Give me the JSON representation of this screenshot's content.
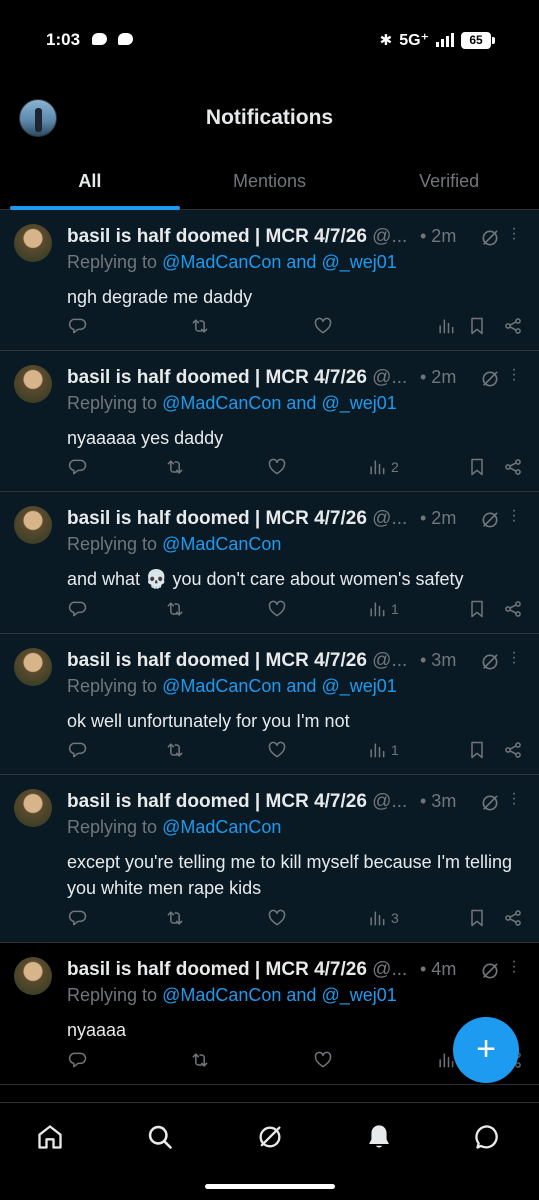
{
  "status": {
    "time": "1:03",
    "network": "5G⁺",
    "battery": "65"
  },
  "header": {
    "title": "Notifications"
  },
  "tabs": [
    {
      "label": "All",
      "active": true
    },
    {
      "label": "Mentions",
      "active": false
    },
    {
      "label": "Verified",
      "active": false
    }
  ],
  "tweets": [
    {
      "name": "basil is half doomed | MCR 4/7/26",
      "handle": "@...",
      "time": "• 2m",
      "reply_prefix": "Replying to",
      "mentions": "@MadCanCon and @_wej01",
      "text": "ngh degrade me daddy",
      "views": ""
    },
    {
      "name": "basil is half doomed | MCR 4/7/26",
      "handle": "@...",
      "time": "• 2m",
      "reply_prefix": "Replying to",
      "mentions": "@MadCanCon and @_wej01",
      "text": "nyaaaaa yes daddy",
      "views": "2"
    },
    {
      "name": "basil is half doomed | MCR 4/7/26",
      "handle": "@...",
      "time": "• 2m",
      "reply_prefix": "Replying to",
      "mentions": "@MadCanCon",
      "text": "and what 💀 you don't care about women's safety",
      "views": "1"
    },
    {
      "name": "basil is half doomed | MCR 4/7/26",
      "handle": "@...",
      "time": "• 3m",
      "reply_prefix": "Replying to",
      "mentions": "@MadCanCon and @_wej01",
      "text": "ok well unfortunately for you I'm not",
      "views": "1"
    },
    {
      "name": "basil is half doomed | MCR 4/7/26",
      "handle": "@...",
      "time": "• 3m",
      "reply_prefix": "Replying to",
      "mentions": "@MadCanCon",
      "text": "except you're telling me to kill myself because I'm telling you white men rape kids",
      "views": "3"
    },
    {
      "name": "basil is half doomed | MCR 4/7/26",
      "handle": "@...",
      "time": "• 4m",
      "reply_prefix": "Replying to",
      "mentions": "@MadCanCon and @_wej01",
      "text": "nyaaaa",
      "views": ""
    }
  ],
  "fab": {
    "label": "+"
  },
  "nav": [
    "home-icon",
    "search-icon",
    "grok-icon",
    "notifications-icon",
    "messages-icon"
  ],
  "colors": {
    "accent": "#1d9bf0",
    "unread_bg": "#0a1a24",
    "muted": "#71767b"
  }
}
